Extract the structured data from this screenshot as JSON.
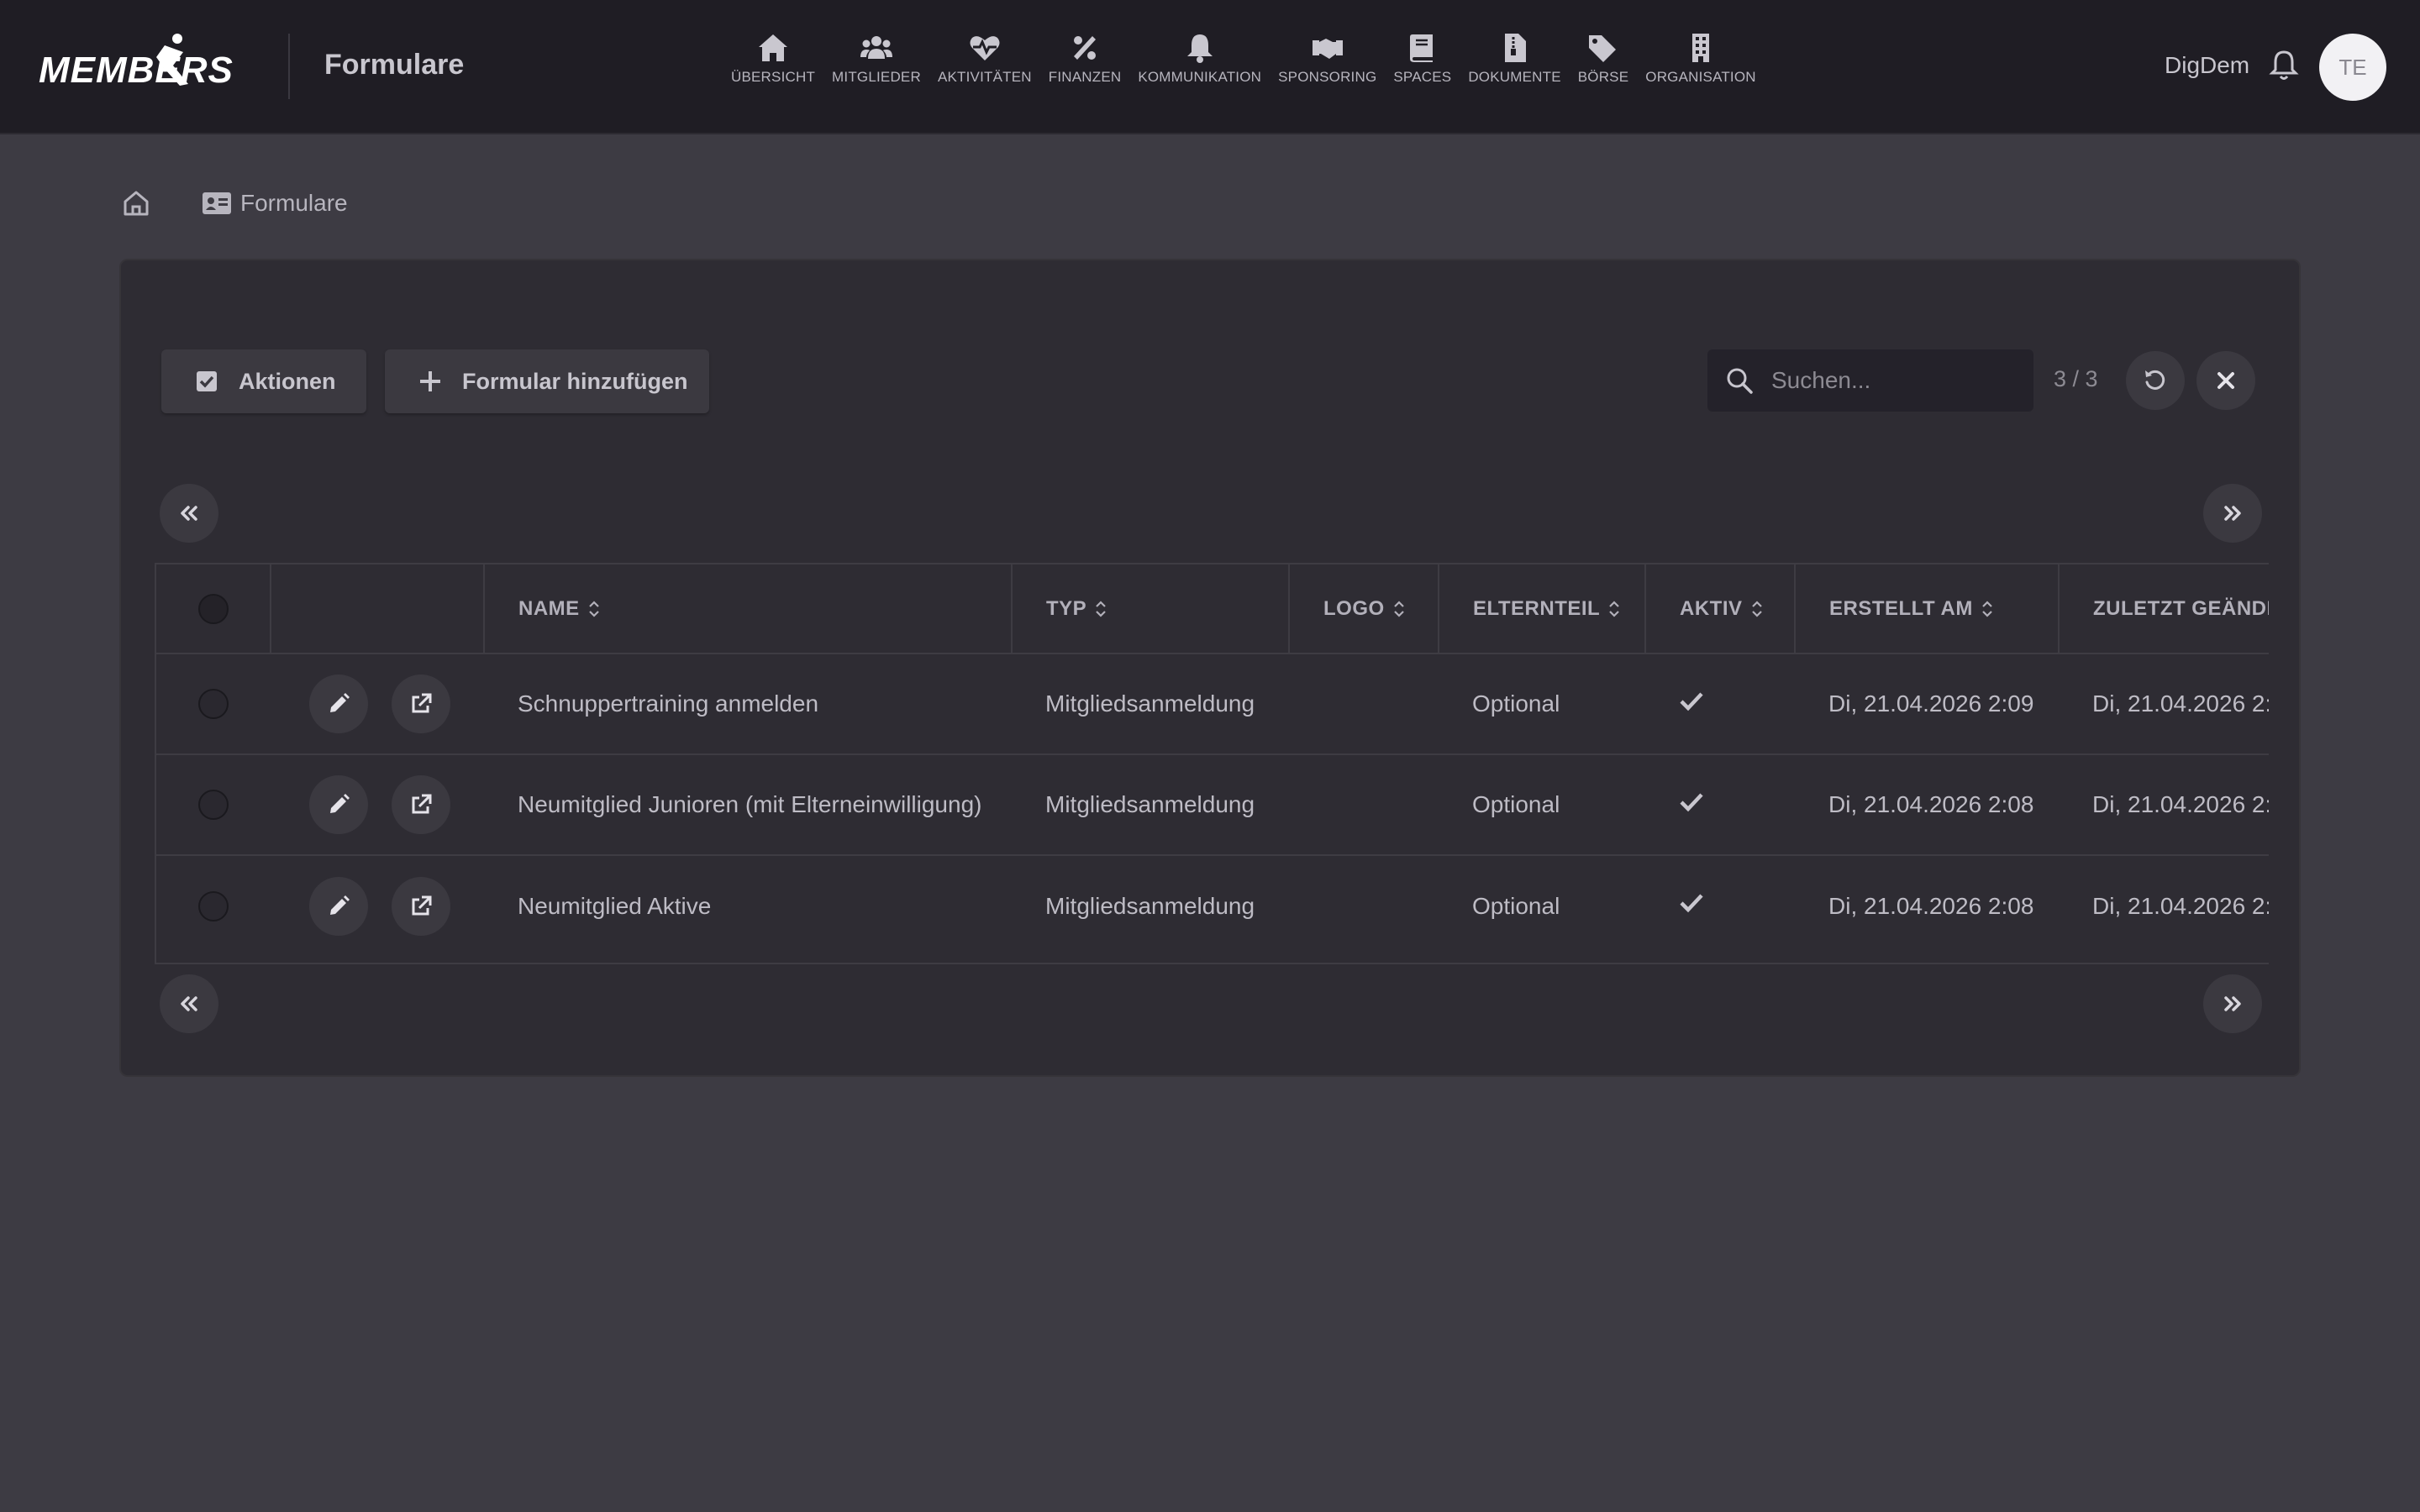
{
  "header": {
    "app_title": "Formulare",
    "user_name": "DigDem",
    "avatar_initials": "TE",
    "nav": [
      {
        "label": "ÜBERSICHT",
        "icon": "home-icon"
      },
      {
        "label": "MITGLIEDER",
        "icon": "users-icon"
      },
      {
        "label": "AKTIVITÄTEN",
        "icon": "heartbeat-icon"
      },
      {
        "label": "FINANZEN",
        "icon": "percent-icon"
      },
      {
        "label": "KOMMUNIKATION",
        "icon": "bell-icon"
      },
      {
        "label": "SPONSORING",
        "icon": "handshake-icon"
      },
      {
        "label": "SPACES",
        "icon": "book-icon"
      },
      {
        "label": "DOKUMENTE",
        "icon": "file-zipper-icon"
      },
      {
        "label": "BÖRSE",
        "icon": "tags-icon"
      },
      {
        "label": "ORGANISATION",
        "icon": "building-icon"
      }
    ]
  },
  "breadcrumb": {
    "current": "Formulare"
  },
  "toolbar": {
    "actions_label": "Aktionen",
    "add_label": "Formular hinzufügen",
    "search_placeholder": "Suchen...",
    "count": "3 / 3"
  },
  "table": {
    "columns": [
      "NAME",
      "TYP",
      "LOGO",
      "ELTERNTEIL",
      "AKTIV",
      "ERSTELLT AM",
      "ZULETZT GEÄNDE"
    ],
    "rows": [
      {
        "name": "Schnuppertraining anmelden",
        "typ": "Mitgliedsanmeldung",
        "logo": "",
        "elternteil": "Optional",
        "aktiv": true,
        "erstellt": "Di, 21.04.2026 2:09",
        "zuletzt": "Di, 21.04.2026 2:0"
      },
      {
        "name": "Neumitglied Junioren (mit Elterneinwilligung)",
        "typ": "Mitgliedsanmeldung",
        "logo": "",
        "elternteil": "Optional",
        "aktiv": true,
        "erstellt": "Di, 21.04.2026 2:08",
        "zuletzt": "Di, 21.04.2026 2:0"
      },
      {
        "name": "Neumitglied Aktive",
        "typ": "Mitgliedsanmeldung",
        "logo": "",
        "elternteil": "Optional",
        "aktiv": true,
        "erstellt": "Di, 21.04.2026 2:08",
        "zuletzt": "Di, 21.04.2026 2:0"
      }
    ]
  },
  "colors": {
    "background": "#3d3b43",
    "topbar": "#1f1d24",
    "card": "#2e2c33",
    "button": "#3b3940"
  }
}
